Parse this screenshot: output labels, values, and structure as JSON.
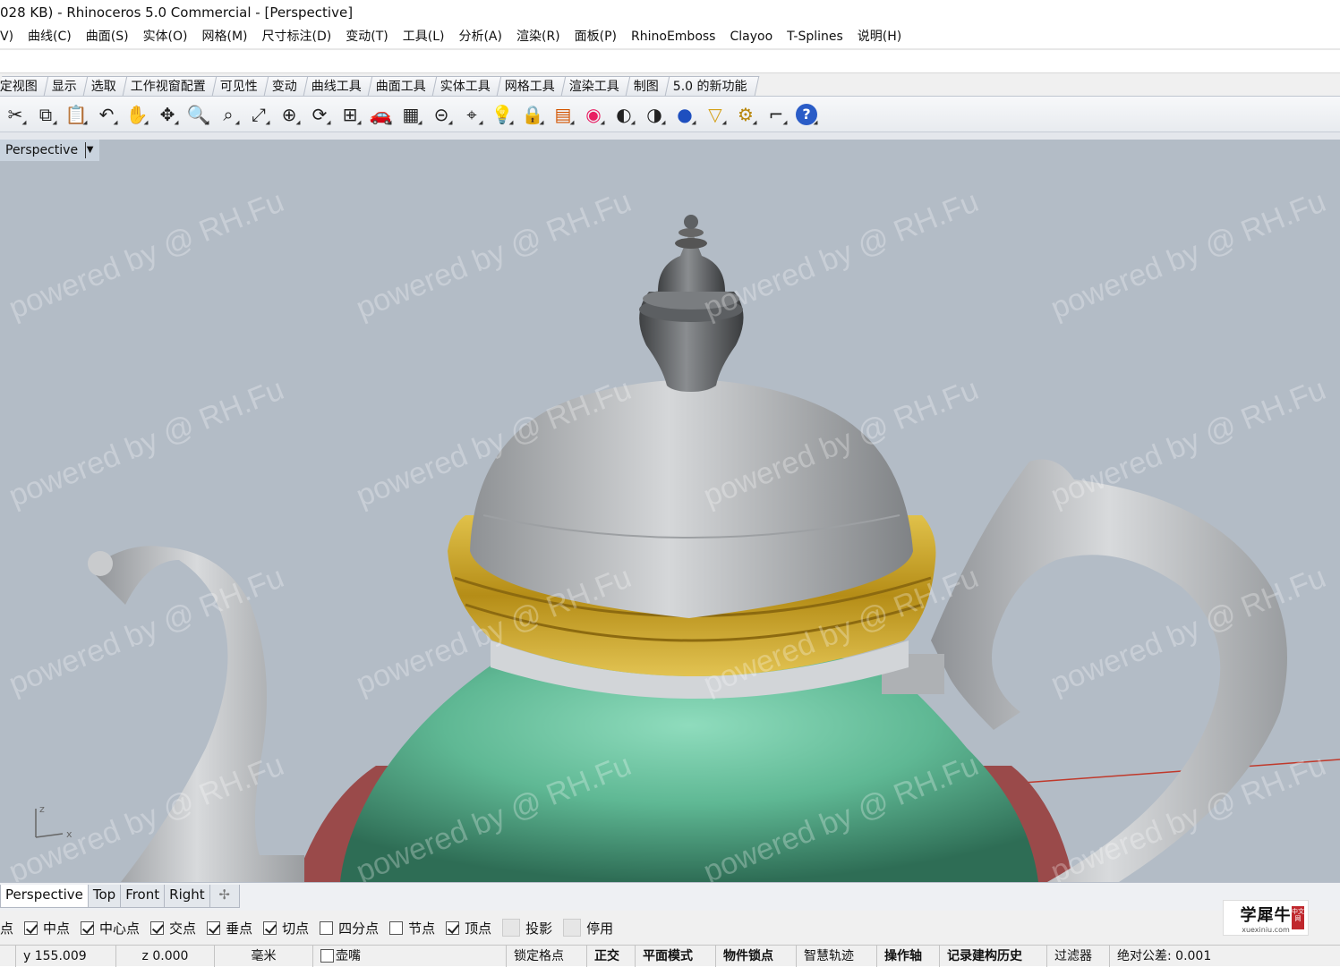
{
  "title": "028 KB) - Rhinoceros 5.0 Commercial - [Perspective]",
  "menu": [
    "V)",
    "曲线(C)",
    "曲面(S)",
    "实体(O)",
    "网格(M)",
    "尺寸标注(D)",
    "变动(T)",
    "工具(L)",
    "分析(A)",
    "渲染(R)",
    "面板(P)",
    "RhinoEmboss",
    "Clayoo",
    "T-Splines",
    "说明(H)"
  ],
  "toolbar_tabs": [
    "定视图",
    "显示",
    "选取",
    "工作视窗配置",
    "可见性",
    "变动",
    "曲线工具",
    "曲面工具",
    "实体工具",
    "网格工具",
    "渲染工具",
    "制图",
    "5.0 的新功能"
  ],
  "toolbar_icons": [
    "cut-icon",
    "copy-icon",
    "paste-icon",
    "undo-icon",
    "pan-icon",
    "rotate-view-icon",
    "zoom-icon",
    "zoom-window-icon",
    "zoom-extents-icon",
    "zoom-selected-icon",
    "rotate-icon",
    "four-viewports-icon",
    "car-icon",
    "grid-icon",
    "ortho-icon",
    "osnap-icon",
    "light-icon",
    "lock-icon",
    "layer-icon",
    "color-wheel-icon",
    "shade-icon",
    "render-preview-icon",
    "render-sphere-icon",
    "filter-icon",
    "options-icon",
    "dimension-icon",
    "help-icon"
  ],
  "viewport": {
    "label": "Perspective",
    "watermark": "powered by @ RH.Fu",
    "axis_z": "z",
    "axis_x": "x"
  },
  "viewport_tabs": [
    "Perspective",
    "Top",
    "Front",
    "Right"
  ],
  "osnaps": [
    {
      "label": "点",
      "checked": null
    },
    {
      "label": "中点",
      "checked": true
    },
    {
      "label": "中心点",
      "checked": true
    },
    {
      "label": "交点",
      "checked": true
    },
    {
      "label": "垂点",
      "checked": true
    },
    {
      "label": "切点",
      "checked": true
    },
    {
      "label": "四分点",
      "checked": false
    },
    {
      "label": "节点",
      "checked": false
    },
    {
      "label": "顶点",
      "checked": true
    },
    {
      "label": "投影",
      "checked": "disabled"
    },
    {
      "label": "停用",
      "checked": "disabled"
    }
  ],
  "logo": {
    "name": "学犀牛",
    "url": "xuexiniu.com",
    "seal": "中文网"
  },
  "status": {
    "y": "y 155.009",
    "z": "z 0.000",
    "unit": "毫米",
    "layer": "壶嘴",
    "grid_snap": "锁定格点",
    "ortho": "正交",
    "planar": "平面模式",
    "osnap": "物件锁点",
    "smarttrack": "智慧轨迹",
    "gumball": "操作轴",
    "history": "记录建构历史",
    "filter": "过滤器",
    "tolerance": "绝对公差: 0.001"
  },
  "colors": {
    "viewport_bg": "#b3bcc6",
    "body_green": "#5fb894",
    "ring_gold": "#c9a227",
    "lid_silver": "#bfc2c5",
    "finial_dark": "#6f7275",
    "base_red": "#9a4a4a"
  }
}
